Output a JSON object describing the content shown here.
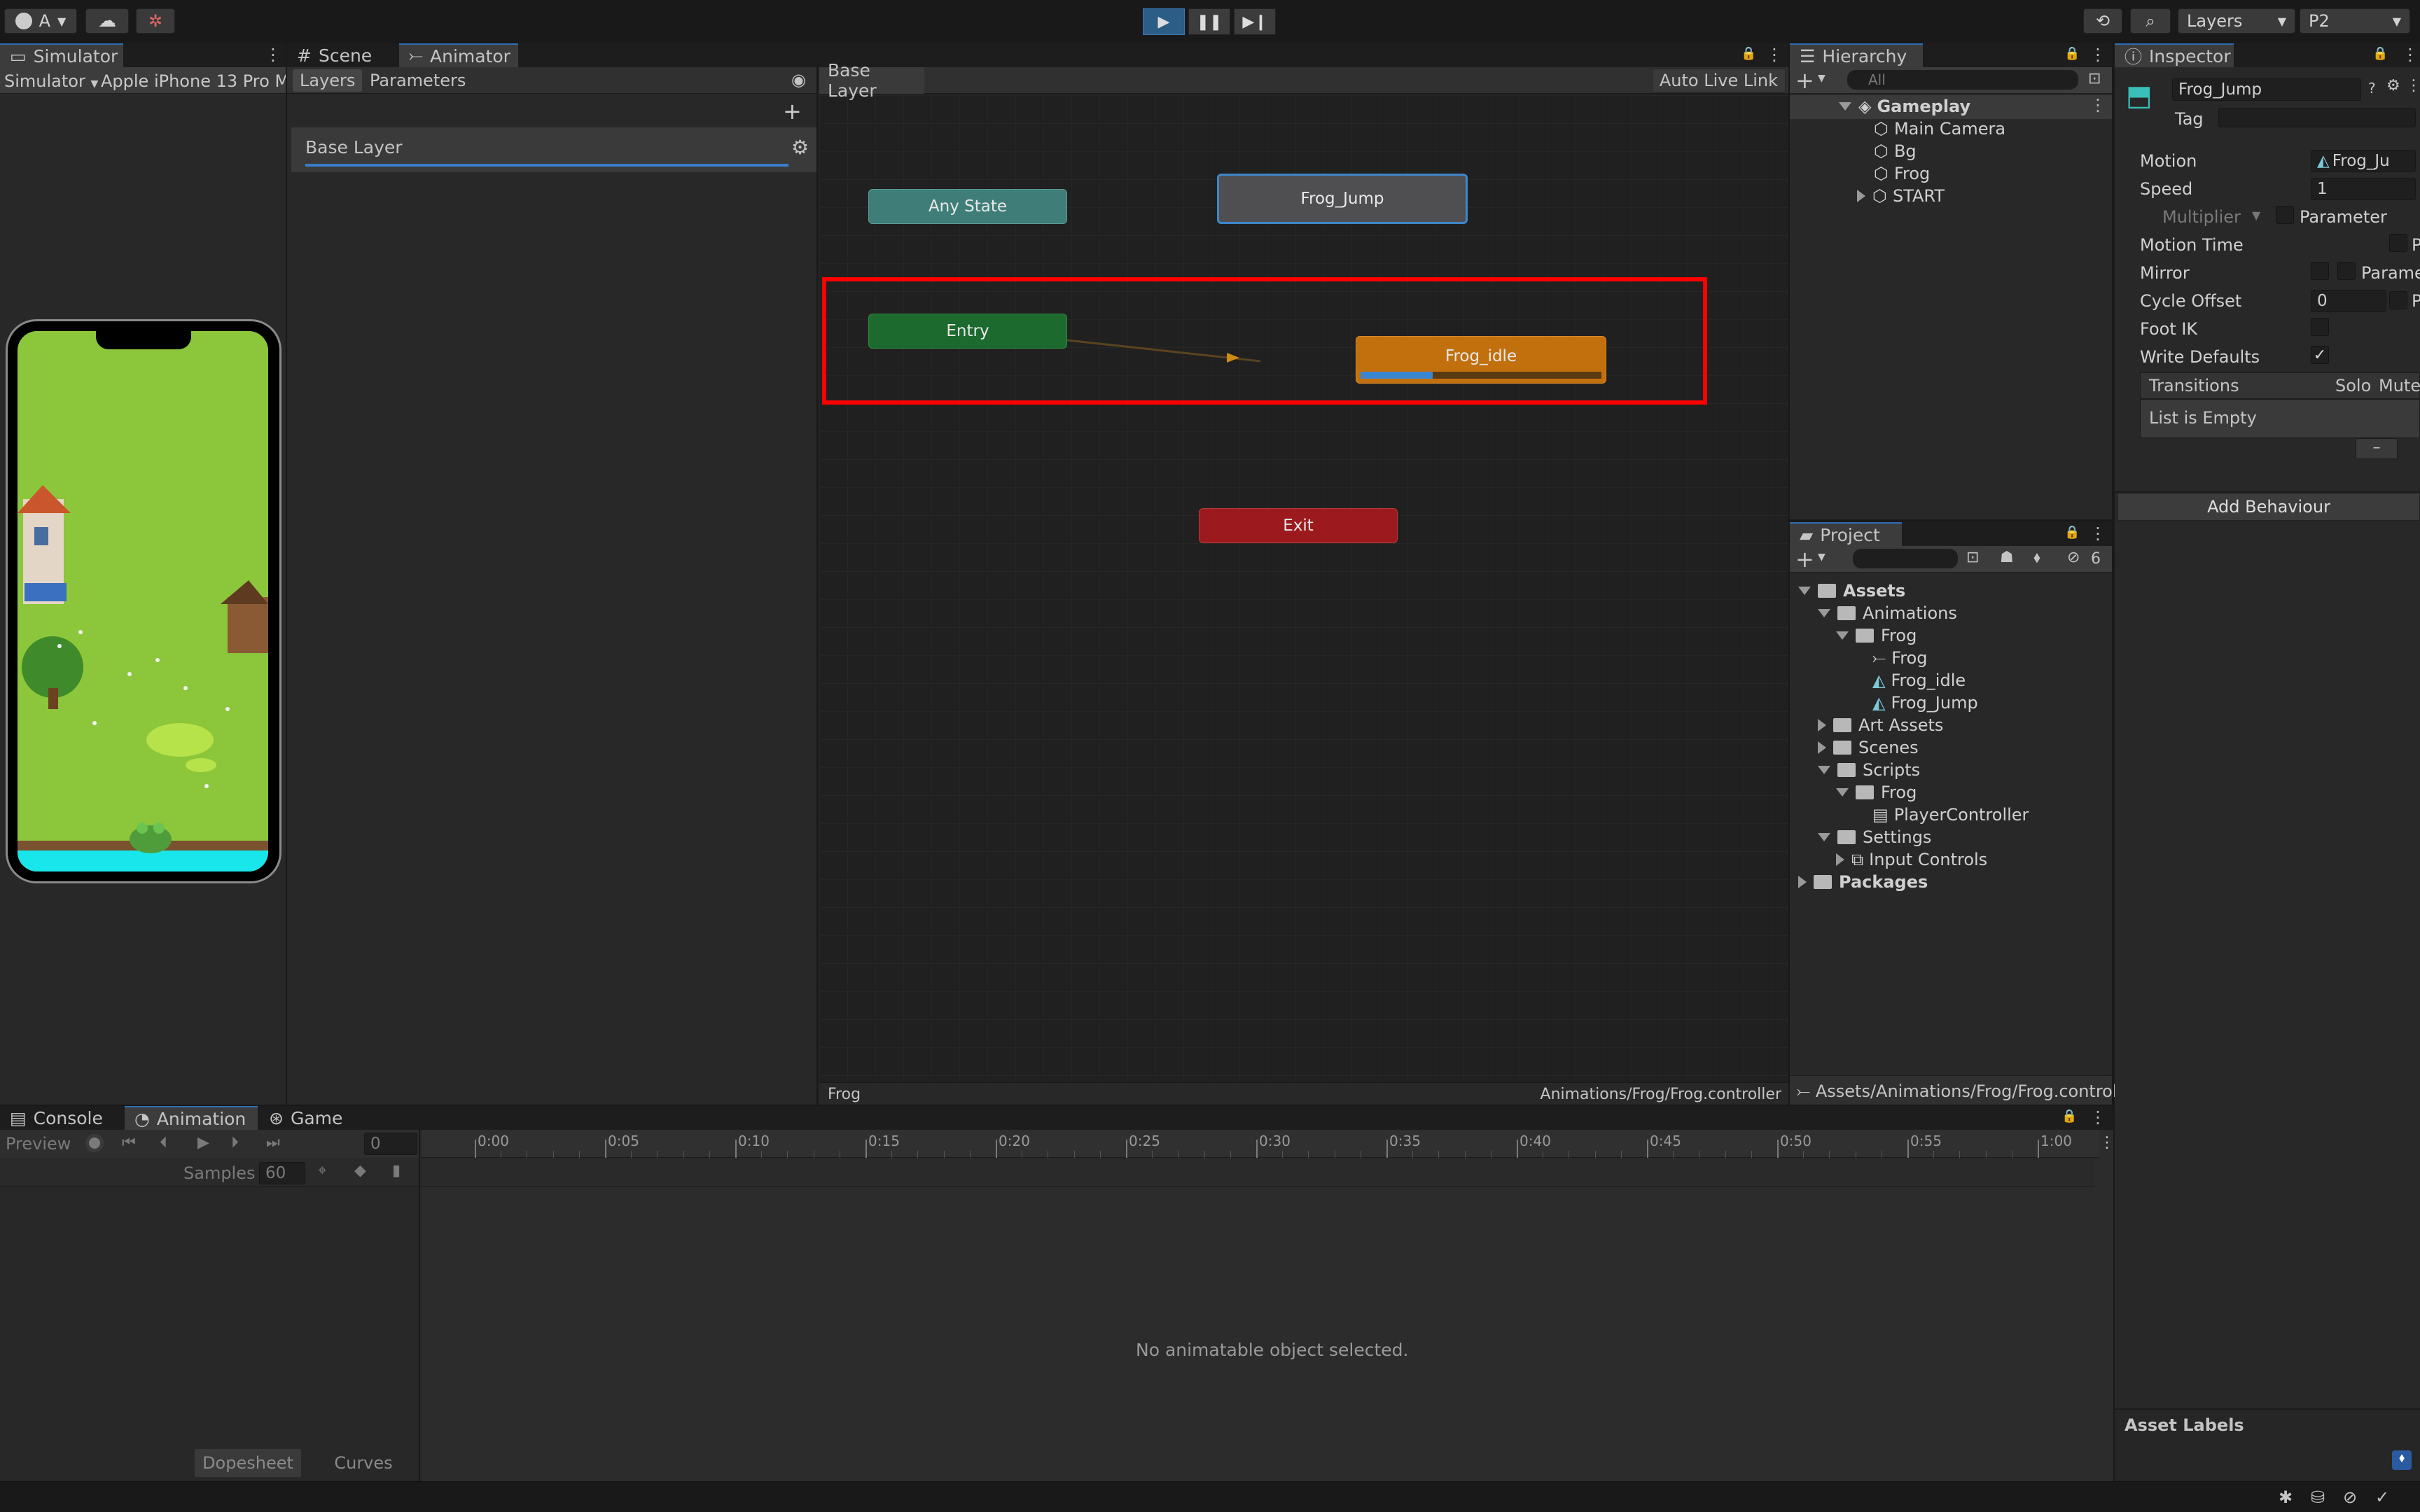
{
  "toolbar": {
    "account_label": "A",
    "layers_label": "Layers",
    "layout_label": "P2"
  },
  "simulator": {
    "tab_label": "Simulator",
    "mode_label": "Simulator",
    "device_label": "Apple iPhone 13 Pro M"
  },
  "animator": {
    "tabs": [
      "Scene",
      "Animator"
    ],
    "layers_tab": "Layers",
    "parameters_tab": "Parameters",
    "layer_name": "Base Layer",
    "breadcrumb": "Base Layer",
    "auto_live_link": "Auto Live Link",
    "footer_left": "Frog",
    "footer_right": "Animations/Frog/Frog.controller",
    "nodes": {
      "any_state": "Any State",
      "frog_jump": "Frog_Jump",
      "entry": "Entry",
      "frog_idle": "Frog_idle",
      "exit": "Exit"
    },
    "frog_idle_progress": 0.3,
    "highlight_color": "#ff0000"
  },
  "hierarchy": {
    "tab_label": "Hierarchy",
    "search_placeholder": "All",
    "scene": "Gameplay",
    "items": [
      "Main Camera",
      "Bg",
      "Frog",
      "START"
    ]
  },
  "project": {
    "tab_label": "Project",
    "hidden_count": "6",
    "tree": {
      "assets": "Assets",
      "animations": "Animations",
      "frog_folder": "Frog",
      "frog_controller": "Frog",
      "frog_idle": "Frog_idle",
      "frog_jump": "Frog_Jump",
      "art_assets": "Art Assets",
      "scenes": "Scenes",
      "scripts": "Scripts",
      "scripts_frog": "Frog",
      "player_controller": "PlayerController",
      "settings": "Settings",
      "input_controls": "Input Controls",
      "packages": "Packages"
    },
    "footer_path": "Assets/Animations/Frog/Frog.controll"
  },
  "inspector": {
    "tab_label": "Inspector",
    "name_value": "Frog_Jump",
    "tag_label": "Tag",
    "motion_label": "Motion",
    "motion_value": "Frog_Ju",
    "speed_label": "Speed",
    "speed_value": "1",
    "multiplier_label": "Multiplier",
    "parameter_label": "Parameter",
    "motion_time_label": "Motion Time",
    "motion_time_suffix": "P",
    "mirror_label": "Mirror",
    "mirror_param": "Parame",
    "cycle_offset_label": "Cycle Offset",
    "cycle_offset_value": "0",
    "cycle_offset_suffix": "P",
    "foot_ik_label": "Foot IK",
    "write_defaults_label": "Write Defaults",
    "write_defaults_checked": "✓",
    "transitions_label": "Transitions",
    "solo_label": "Solo",
    "mute_label": "Mute",
    "list_empty": "List is Empty",
    "minus": "–",
    "add_behaviour": "Add Behaviour",
    "asset_labels": "Asset Labels"
  },
  "bottom": {
    "tabs": [
      "Console",
      "Animation",
      "Game"
    ],
    "preview_label": "Preview",
    "frame_value": "0",
    "samples_label": "Samples",
    "samples_value": "60",
    "ticks": [
      "0:00",
      "0:05",
      "0:10",
      "0:15",
      "0:20",
      "0:25",
      "0:30",
      "0:35",
      "0:40",
      "0:45",
      "0:50",
      "0:55",
      "1:00"
    ],
    "empty_message": "No animatable object selected.",
    "dopesheet": "Dopesheet",
    "curves": "Curves"
  }
}
